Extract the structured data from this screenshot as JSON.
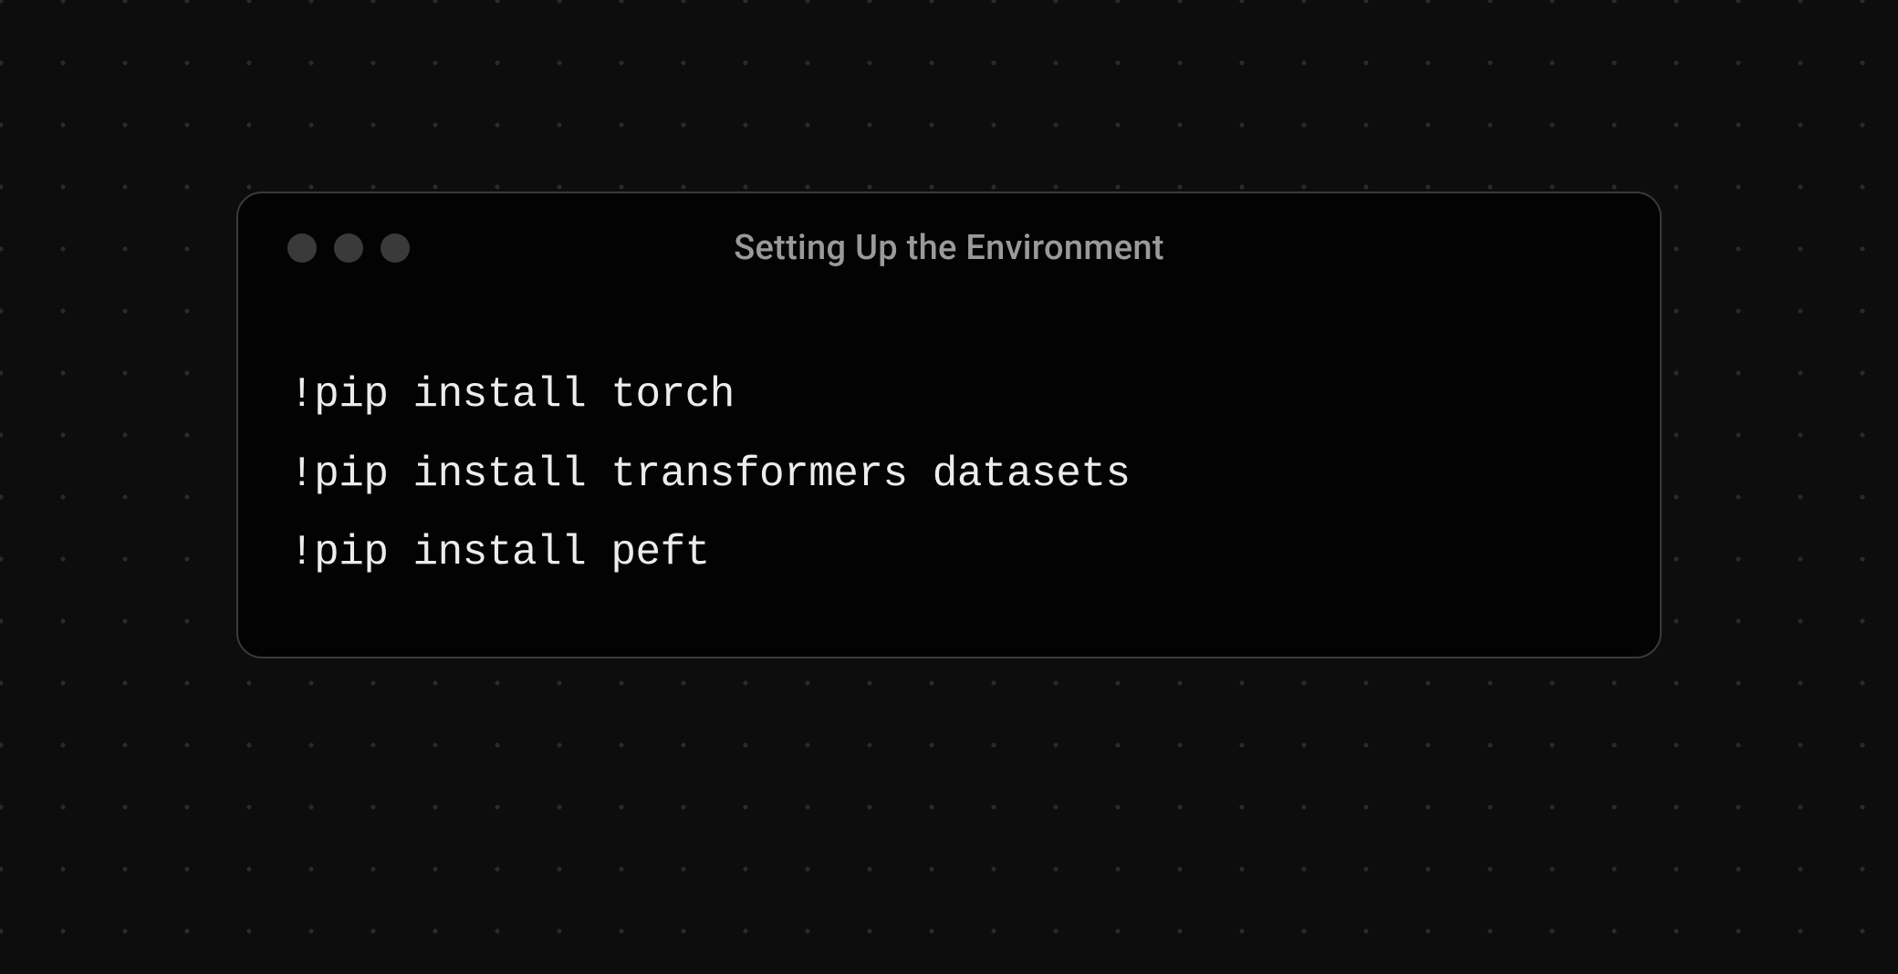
{
  "window": {
    "title": "Setting Up the Environment"
  },
  "code": {
    "lines": [
      "!pip install torch",
      "!pip install transformers datasets",
      "!pip install peft"
    ]
  }
}
